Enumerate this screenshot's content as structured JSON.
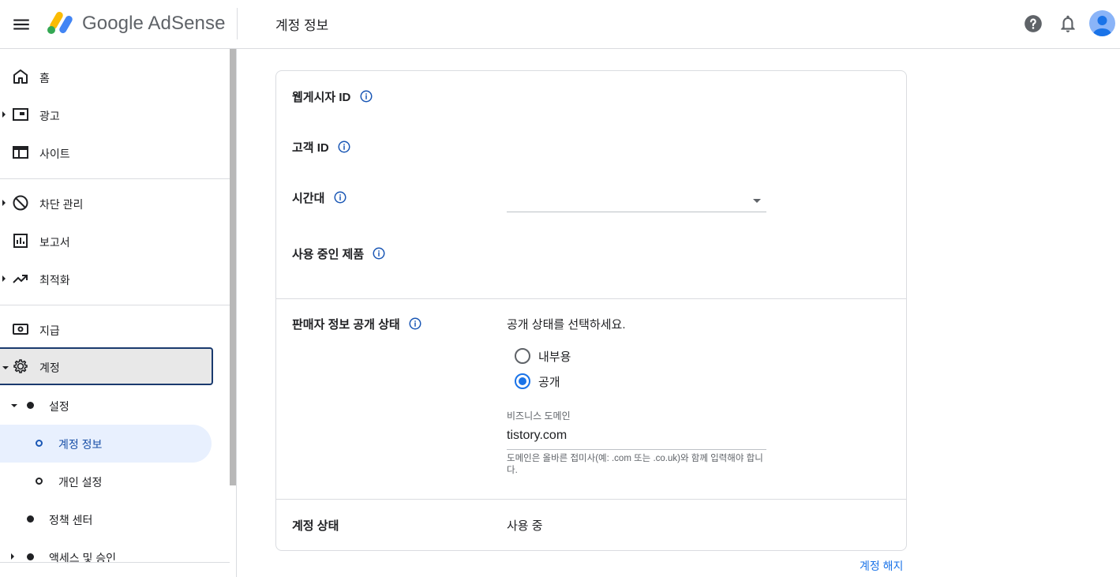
{
  "header": {
    "brand": "Google AdSense",
    "page_title": "계정 정보",
    "icons": {
      "menu": "menu-icon",
      "help": "help-icon",
      "notifications": "bell-icon",
      "account": "avatar"
    },
    "colors": {
      "logo_yellow": "#fbbc04",
      "logo_green": "#34a853",
      "logo_blue": "#4285f4",
      "accent": "#1a73e8"
    }
  },
  "sidebar": {
    "items": [
      {
        "label": "홈",
        "icon": "home-icon"
      },
      {
        "label": "광고",
        "icon": "ads-icon"
      },
      {
        "label": "사이트",
        "icon": "sites-icon"
      },
      {
        "label": "차단 관리",
        "icon": "block-icon"
      },
      {
        "label": "보고서",
        "icon": "reports-icon"
      },
      {
        "label": "최적화",
        "icon": "trending-icon"
      },
      {
        "label": "지급",
        "icon": "payments-icon"
      },
      {
        "label": "계정",
        "icon": "gear-icon"
      }
    ],
    "sub_items": [
      {
        "label": "설정"
      },
      {
        "label": "계정 정보"
      },
      {
        "label": "개인 설정"
      },
      {
        "label": "정책 센터"
      },
      {
        "label": "액세스 및 승인"
      }
    ]
  },
  "card": {
    "publisher_id_label": "웹게시자 ID",
    "customer_id_label": "고객 ID",
    "timezone_label": "시간대",
    "timezone_value": "",
    "products_label": "사용 중인 제품",
    "seller_info_label": "판매자 정보 공개 상태",
    "visibility_prompt": "공개 상태를 선택하세요.",
    "radio_options": [
      {
        "label": "내부용",
        "checked": false
      },
      {
        "label": "공개",
        "checked": true
      }
    ],
    "business_domain_label": "비즈니스 도메인",
    "business_domain_value": "tistory.com",
    "domain_hint": "도메인은 올바른 접미사(예: .com 또는 .co.uk)와 함께 입력해야 합니다.",
    "account_status_label": "계정 상태",
    "account_status_value": "사용 중"
  },
  "footer": {
    "terminate_link": "계정 해지"
  }
}
